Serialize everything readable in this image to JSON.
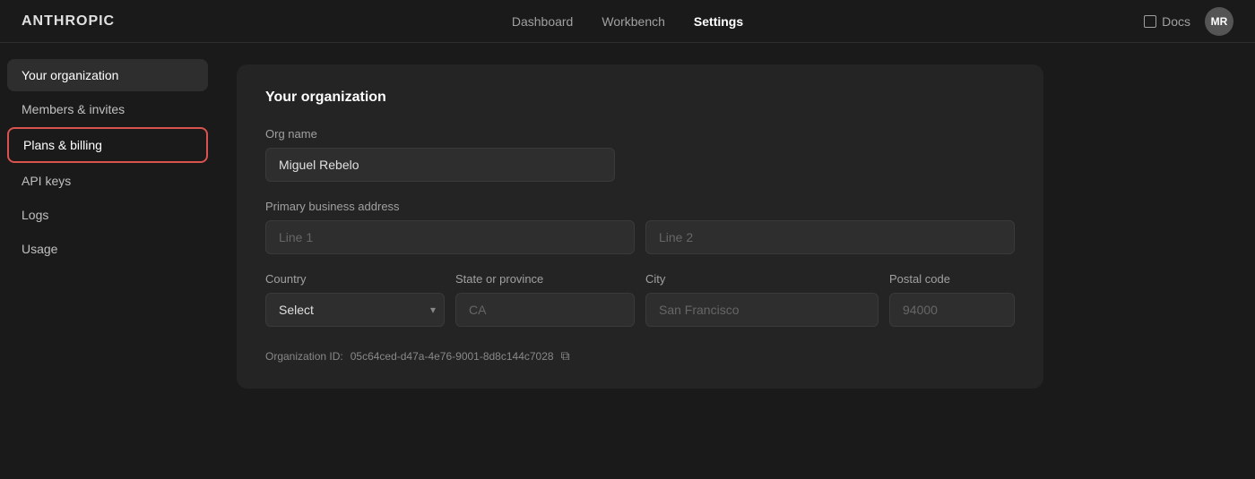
{
  "header": {
    "logo": "ANTHROPIC",
    "nav": [
      {
        "label": "Dashboard",
        "active": false
      },
      {
        "label": "Workbench",
        "active": false
      },
      {
        "label": "Settings",
        "active": true
      }
    ],
    "docs_label": "Docs",
    "avatar_initials": "MR"
  },
  "sidebar": {
    "items": [
      {
        "label": "Your organization",
        "active": true,
        "outlined": false
      },
      {
        "label": "Members & invites",
        "active": false,
        "outlined": false
      },
      {
        "label": "Plans & billing",
        "active": false,
        "outlined": true
      },
      {
        "label": "API keys",
        "active": false,
        "outlined": false
      },
      {
        "label": "Logs",
        "active": false,
        "outlined": false
      },
      {
        "label": "Usage",
        "active": false,
        "outlined": false
      }
    ]
  },
  "main": {
    "card_title": "Your organization",
    "org_name_label": "Org name",
    "org_name_value": "Miguel Rebelo",
    "address_label": "Primary business address",
    "address_line1_placeholder": "Line 1",
    "address_line2_placeholder": "Line 2",
    "country_label": "Country",
    "country_placeholder": "Select",
    "state_label": "State or province",
    "state_placeholder": "CA",
    "city_label": "City",
    "city_placeholder": "San Francisco",
    "postal_label": "Postal code",
    "postal_placeholder": "94000",
    "org_id_prefix": "Organization ID:",
    "org_id": "05c64ced-d47a-4e76-9001-8d8c144c7028",
    "copy_icon_label": "⧉"
  }
}
